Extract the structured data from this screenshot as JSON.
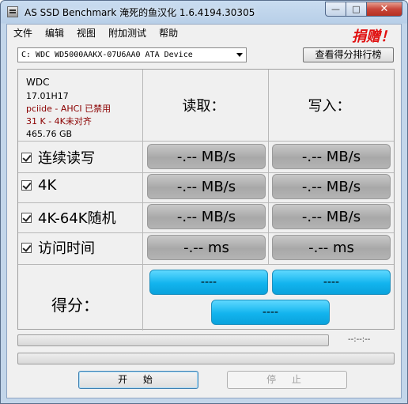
{
  "window": {
    "title": "AS SSD Benchmark 淹死的鱼汉化 1.6.4194.30305",
    "minimize_glyph": "—",
    "maximize_glyph": "□",
    "close_glyph": "✕"
  },
  "menu": {
    "items": [
      "文件",
      "编辑",
      "视图",
      "附加测试",
      "帮助"
    ],
    "donate": "捐赠！"
  },
  "drive": {
    "selected": "C: WDC WD5000AAKX-07U6AA0 ATA Device",
    "rank_button": "查看得分排行榜"
  },
  "info": {
    "model": "WDC",
    "firmware": "17.01H17",
    "driver": "pciide - AHCI 已禁用",
    "alignment": "31 K - 4K未对齐",
    "size": "465.76 GB"
  },
  "columns": {
    "read": "读取：",
    "write": "写入："
  },
  "tests": [
    {
      "label": "连续读写",
      "checked": true,
      "read": "-.-- MB/s",
      "write": "-.-- MB/s"
    },
    {
      "label": "4K",
      "checked": true,
      "read": "-.-- MB/s",
      "write": "-.-- MB/s"
    },
    {
      "label": "4K-64K随机",
      "checked": true,
      "read": "-.-- MB/s",
      "write": "-.-- MB/s"
    },
    {
      "label": "访问时间",
      "checked": true,
      "read": "-.-- ms",
      "write": "-.-- ms"
    }
  ],
  "score": {
    "label": "得分：",
    "read": "----",
    "write": "----",
    "total": "----"
  },
  "progress": {
    "timer": "--:--:--",
    "value": 0
  },
  "buttons": {
    "start": "开 始",
    "stop": "停 止"
  },
  "colors": {
    "accent": "#12b4ee",
    "donate": "#e01010",
    "info_red": "#8b0000"
  }
}
